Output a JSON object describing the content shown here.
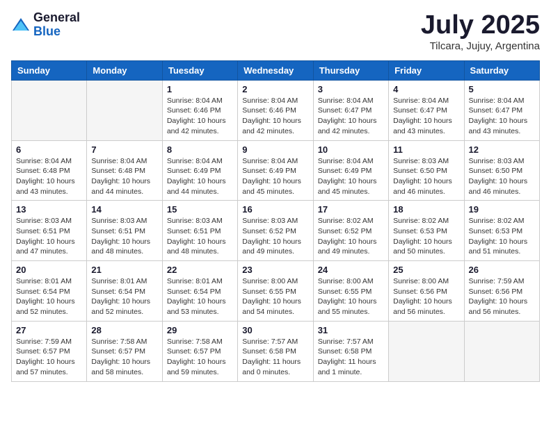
{
  "header": {
    "logo_general": "General",
    "logo_blue": "Blue",
    "month_title": "July 2025",
    "subtitle": "Tilcara, Jujuy, Argentina"
  },
  "weekdays": [
    "Sunday",
    "Monday",
    "Tuesday",
    "Wednesday",
    "Thursday",
    "Friday",
    "Saturday"
  ],
  "weeks": [
    [
      {
        "day": "",
        "empty": true
      },
      {
        "day": "",
        "empty": true
      },
      {
        "day": "1",
        "sunrise": "Sunrise: 8:04 AM",
        "sunset": "Sunset: 6:46 PM",
        "daylight": "Daylight: 10 hours and 42 minutes."
      },
      {
        "day": "2",
        "sunrise": "Sunrise: 8:04 AM",
        "sunset": "Sunset: 6:46 PM",
        "daylight": "Daylight: 10 hours and 42 minutes."
      },
      {
        "day": "3",
        "sunrise": "Sunrise: 8:04 AM",
        "sunset": "Sunset: 6:47 PM",
        "daylight": "Daylight: 10 hours and 42 minutes."
      },
      {
        "day": "4",
        "sunrise": "Sunrise: 8:04 AM",
        "sunset": "Sunset: 6:47 PM",
        "daylight": "Daylight: 10 hours and 43 minutes."
      },
      {
        "day": "5",
        "sunrise": "Sunrise: 8:04 AM",
        "sunset": "Sunset: 6:47 PM",
        "daylight": "Daylight: 10 hours and 43 minutes."
      }
    ],
    [
      {
        "day": "6",
        "sunrise": "Sunrise: 8:04 AM",
        "sunset": "Sunset: 6:48 PM",
        "daylight": "Daylight: 10 hours and 43 minutes."
      },
      {
        "day": "7",
        "sunrise": "Sunrise: 8:04 AM",
        "sunset": "Sunset: 6:48 PM",
        "daylight": "Daylight: 10 hours and 44 minutes."
      },
      {
        "day": "8",
        "sunrise": "Sunrise: 8:04 AM",
        "sunset": "Sunset: 6:49 PM",
        "daylight": "Daylight: 10 hours and 44 minutes."
      },
      {
        "day": "9",
        "sunrise": "Sunrise: 8:04 AM",
        "sunset": "Sunset: 6:49 PM",
        "daylight": "Daylight: 10 hours and 45 minutes."
      },
      {
        "day": "10",
        "sunrise": "Sunrise: 8:04 AM",
        "sunset": "Sunset: 6:49 PM",
        "daylight": "Daylight: 10 hours and 45 minutes."
      },
      {
        "day": "11",
        "sunrise": "Sunrise: 8:03 AM",
        "sunset": "Sunset: 6:50 PM",
        "daylight": "Daylight: 10 hours and 46 minutes."
      },
      {
        "day": "12",
        "sunrise": "Sunrise: 8:03 AM",
        "sunset": "Sunset: 6:50 PM",
        "daylight": "Daylight: 10 hours and 46 minutes."
      }
    ],
    [
      {
        "day": "13",
        "sunrise": "Sunrise: 8:03 AM",
        "sunset": "Sunset: 6:51 PM",
        "daylight": "Daylight: 10 hours and 47 minutes."
      },
      {
        "day": "14",
        "sunrise": "Sunrise: 8:03 AM",
        "sunset": "Sunset: 6:51 PM",
        "daylight": "Daylight: 10 hours and 48 minutes."
      },
      {
        "day": "15",
        "sunrise": "Sunrise: 8:03 AM",
        "sunset": "Sunset: 6:51 PM",
        "daylight": "Daylight: 10 hours and 48 minutes."
      },
      {
        "day": "16",
        "sunrise": "Sunrise: 8:03 AM",
        "sunset": "Sunset: 6:52 PM",
        "daylight": "Daylight: 10 hours and 49 minutes."
      },
      {
        "day": "17",
        "sunrise": "Sunrise: 8:02 AM",
        "sunset": "Sunset: 6:52 PM",
        "daylight": "Daylight: 10 hours and 49 minutes."
      },
      {
        "day": "18",
        "sunrise": "Sunrise: 8:02 AM",
        "sunset": "Sunset: 6:53 PM",
        "daylight": "Daylight: 10 hours and 50 minutes."
      },
      {
        "day": "19",
        "sunrise": "Sunrise: 8:02 AM",
        "sunset": "Sunset: 6:53 PM",
        "daylight": "Daylight: 10 hours and 51 minutes."
      }
    ],
    [
      {
        "day": "20",
        "sunrise": "Sunrise: 8:01 AM",
        "sunset": "Sunset: 6:54 PM",
        "daylight": "Daylight: 10 hours and 52 minutes."
      },
      {
        "day": "21",
        "sunrise": "Sunrise: 8:01 AM",
        "sunset": "Sunset: 6:54 PM",
        "daylight": "Daylight: 10 hours and 52 minutes."
      },
      {
        "day": "22",
        "sunrise": "Sunrise: 8:01 AM",
        "sunset": "Sunset: 6:54 PM",
        "daylight": "Daylight: 10 hours and 53 minutes."
      },
      {
        "day": "23",
        "sunrise": "Sunrise: 8:00 AM",
        "sunset": "Sunset: 6:55 PM",
        "daylight": "Daylight: 10 hours and 54 minutes."
      },
      {
        "day": "24",
        "sunrise": "Sunrise: 8:00 AM",
        "sunset": "Sunset: 6:55 PM",
        "daylight": "Daylight: 10 hours and 55 minutes."
      },
      {
        "day": "25",
        "sunrise": "Sunrise: 8:00 AM",
        "sunset": "Sunset: 6:56 PM",
        "daylight": "Daylight: 10 hours and 56 minutes."
      },
      {
        "day": "26",
        "sunrise": "Sunrise: 7:59 AM",
        "sunset": "Sunset: 6:56 PM",
        "daylight": "Daylight: 10 hours and 56 minutes."
      }
    ],
    [
      {
        "day": "27",
        "sunrise": "Sunrise: 7:59 AM",
        "sunset": "Sunset: 6:57 PM",
        "daylight": "Daylight: 10 hours and 57 minutes."
      },
      {
        "day": "28",
        "sunrise": "Sunrise: 7:58 AM",
        "sunset": "Sunset: 6:57 PM",
        "daylight": "Daylight: 10 hours and 58 minutes."
      },
      {
        "day": "29",
        "sunrise": "Sunrise: 7:58 AM",
        "sunset": "Sunset: 6:57 PM",
        "daylight": "Daylight: 10 hours and 59 minutes."
      },
      {
        "day": "30",
        "sunrise": "Sunrise: 7:57 AM",
        "sunset": "Sunset: 6:58 PM",
        "daylight": "Daylight: 11 hours and 0 minutes."
      },
      {
        "day": "31",
        "sunrise": "Sunrise: 7:57 AM",
        "sunset": "Sunset: 6:58 PM",
        "daylight": "Daylight: 11 hours and 1 minute."
      },
      {
        "day": "",
        "empty": true
      },
      {
        "day": "",
        "empty": true
      }
    ]
  ]
}
